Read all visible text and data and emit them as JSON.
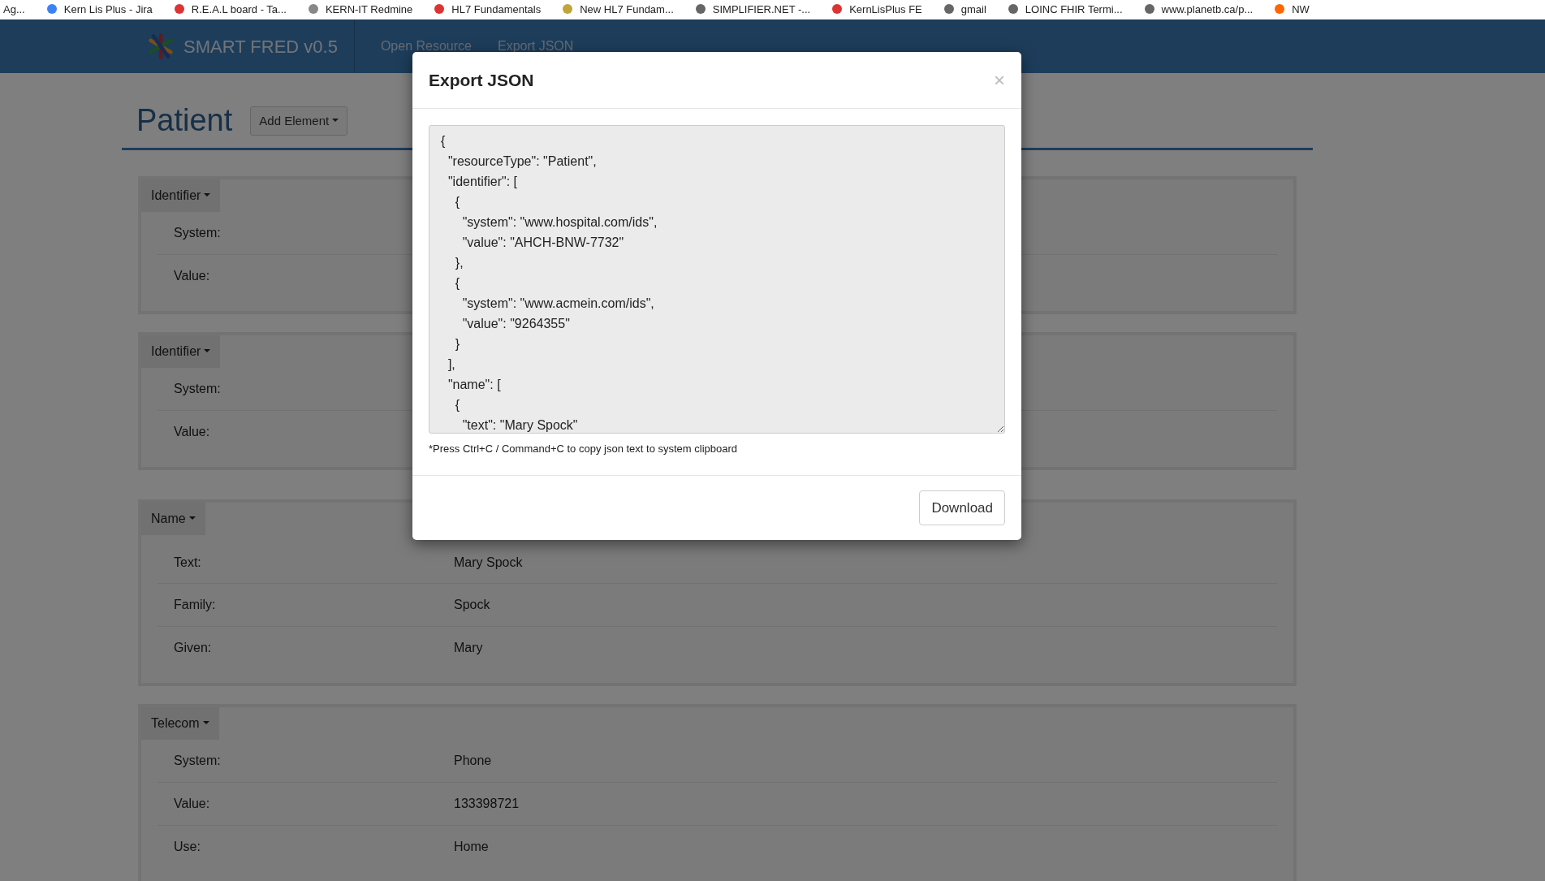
{
  "bookmarks": [
    {
      "label": "Ag..."
    },
    {
      "label": "Kern Lis Plus - Jira"
    },
    {
      "label": "R.E.A.L board - Ta..."
    },
    {
      "label": "KERN-IT Redmine"
    },
    {
      "label": "HL7 Fundamentals"
    },
    {
      "label": "New HL7 Fundam..."
    },
    {
      "label": "SIMPLIFIER.NET -..."
    },
    {
      "label": "KernLisPlus FE"
    },
    {
      "label": "gmail"
    },
    {
      "label": "LOINC FHIR Termi..."
    },
    {
      "label": "www.planetb.ca/p..."
    },
    {
      "label": "NW"
    }
  ],
  "navbar": {
    "brand": "SMART FRED v0.5",
    "links": [
      {
        "label": "Open Resource"
      },
      {
        "label": "Export JSON"
      }
    ]
  },
  "page": {
    "title": "Patient",
    "add_button": "Add Element"
  },
  "sections": [
    {
      "title": "Identifier",
      "fields": [
        {
          "label": "System:"
        },
        {
          "label": "Value:"
        }
      ]
    },
    {
      "title": "Identifier",
      "fields": [
        {
          "label": "System:"
        },
        {
          "label": "Value:"
        }
      ]
    },
    {
      "title": "Name",
      "fields": [
        {
          "label": "Text:",
          "value": "Mary Spock"
        },
        {
          "label": "Family:",
          "value": "Spock"
        },
        {
          "label": "Given:",
          "value": "Mary"
        }
      ]
    },
    {
      "title": "Telecom",
      "fields": [
        {
          "label": "System:",
          "value": "Phone"
        },
        {
          "label": "Value:",
          "value": "133398721"
        },
        {
          "label": "Use:",
          "value": "Home"
        }
      ]
    }
  ],
  "modal": {
    "title": "Export JSON",
    "close": "×",
    "json_text": "{\n  \"resourceType\": \"Patient\",\n  \"identifier\": [\n    {\n      \"system\": \"www.hospital.com/ids\",\n      \"value\": \"AHCH-BNW-7732\"\n    },\n    {\n      \"system\": \"www.acmein.com/ids\",\n      \"value\": \"9264355\"\n    }\n  ],\n  \"name\": [\n    {\n      \"text\": \"Mary Spock\"",
    "hint": "*Press Ctrl+C / Command+C to copy json text to system clipboard",
    "download": "Download"
  }
}
